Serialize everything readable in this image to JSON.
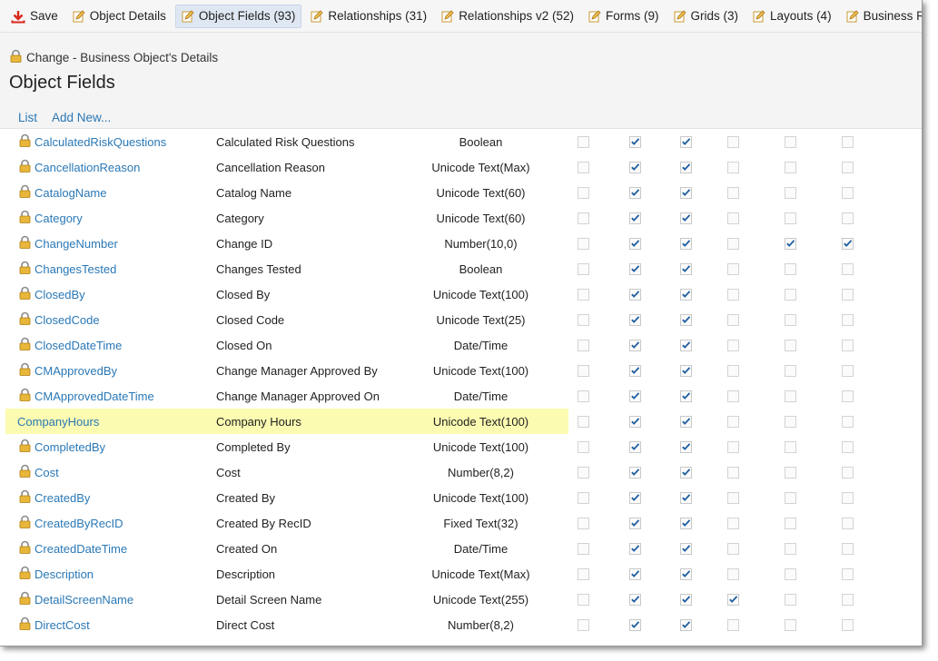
{
  "toolbar": {
    "items": [
      {
        "label": "Save",
        "icon": "save-icon",
        "active": false
      },
      {
        "label": "Object Details",
        "icon": "edit-icon",
        "active": false
      },
      {
        "label": "Object Fields (93)",
        "icon": "edit-icon",
        "active": true
      },
      {
        "label": "Relationships (31)",
        "icon": "edit-icon",
        "active": false
      },
      {
        "label": "Relationships v2 (52)",
        "icon": "edit-icon",
        "active": false
      },
      {
        "label": "Forms (9)",
        "icon": "edit-icon",
        "active": false
      },
      {
        "label": "Grids (3)",
        "icon": "edit-icon",
        "active": false
      },
      {
        "label": "Layouts (4)",
        "icon": "edit-icon",
        "active": false
      },
      {
        "label": "Business Rul",
        "icon": "edit-icon",
        "active": false
      }
    ]
  },
  "header": {
    "business_object": "Change - Business Object's Details",
    "page_title": "Object Fields",
    "links": [
      "List",
      "Add New..."
    ]
  },
  "colors": {
    "link": "#2a78b6",
    "highlight": "#fbfbb1",
    "check": "#1f5fa0"
  },
  "fields": [
    {
      "name": "CalculatedRiskQuestions",
      "display": "Calculated Risk Questions",
      "type": "Boolean",
      "locked": true,
      "checks": [
        false,
        true,
        true,
        false,
        false,
        false
      ]
    },
    {
      "name": "CancellationReason",
      "display": "Cancellation Reason",
      "type": "Unicode Text(Max)",
      "locked": true,
      "checks": [
        false,
        true,
        true,
        false,
        false,
        false
      ]
    },
    {
      "name": "CatalogName",
      "display": "Catalog Name",
      "type": "Unicode Text(60)",
      "locked": true,
      "checks": [
        false,
        true,
        true,
        false,
        false,
        false
      ]
    },
    {
      "name": "Category",
      "display": "Category",
      "type": "Unicode Text(60)",
      "locked": true,
      "checks": [
        false,
        true,
        true,
        false,
        false,
        false
      ]
    },
    {
      "name": "ChangeNumber",
      "display": "Change ID",
      "type": "Number(10,0)",
      "locked": true,
      "checks": [
        false,
        true,
        true,
        false,
        true,
        true
      ]
    },
    {
      "name": "ChangesTested",
      "display": "Changes Tested",
      "type": "Boolean",
      "locked": true,
      "checks": [
        false,
        true,
        true,
        false,
        false,
        false
      ]
    },
    {
      "name": "ClosedBy",
      "display": "Closed By",
      "type": "Unicode Text(100)",
      "locked": true,
      "checks": [
        false,
        true,
        true,
        false,
        false,
        false
      ]
    },
    {
      "name": "ClosedCode",
      "display": "Closed Code",
      "type": "Unicode Text(25)",
      "locked": true,
      "checks": [
        false,
        true,
        true,
        false,
        false,
        false
      ]
    },
    {
      "name": "ClosedDateTime",
      "display": "Closed On",
      "type": "Date/Time",
      "locked": true,
      "checks": [
        false,
        true,
        true,
        false,
        false,
        false
      ]
    },
    {
      "name": "CMApprovedBy",
      "display": "Change Manager Approved By",
      "type": "Unicode Text(100)",
      "locked": true,
      "checks": [
        false,
        true,
        true,
        false,
        false,
        false
      ]
    },
    {
      "name": "CMApprovedDateTime",
      "display": "Change Manager Approved On",
      "type": "Date/Time",
      "locked": true,
      "checks": [
        false,
        true,
        true,
        false,
        false,
        false
      ]
    },
    {
      "name": "CompanyHours",
      "display": "Company Hours",
      "type": "Unicode Text(100)",
      "locked": false,
      "highlight": true,
      "checks": [
        false,
        true,
        true,
        false,
        false,
        false
      ]
    },
    {
      "name": "CompletedBy",
      "display": "Completed By",
      "type": "Unicode Text(100)",
      "locked": true,
      "checks": [
        false,
        true,
        true,
        false,
        false,
        false
      ]
    },
    {
      "name": "Cost",
      "display": "Cost",
      "type": "Number(8,2)",
      "locked": true,
      "checks": [
        false,
        true,
        true,
        false,
        false,
        false
      ]
    },
    {
      "name": "CreatedBy",
      "display": "Created By",
      "type": "Unicode Text(100)",
      "locked": true,
      "checks": [
        false,
        true,
        true,
        false,
        false,
        false
      ]
    },
    {
      "name": "CreatedByRecID",
      "display": "Created By RecID",
      "type": "Fixed Text(32)",
      "locked": true,
      "checks": [
        false,
        true,
        true,
        false,
        false,
        false
      ]
    },
    {
      "name": "CreatedDateTime",
      "display": "Created On",
      "type": "Date/Time",
      "locked": true,
      "checks": [
        false,
        true,
        true,
        false,
        false,
        false
      ]
    },
    {
      "name": "Description",
      "display": "Description",
      "type": "Unicode Text(Max)",
      "locked": true,
      "checks": [
        false,
        true,
        true,
        false,
        false,
        false
      ]
    },
    {
      "name": "DetailScreenName",
      "display": "Detail Screen Name",
      "type": "Unicode Text(255)",
      "locked": true,
      "checks": [
        false,
        true,
        true,
        true,
        false,
        false
      ]
    },
    {
      "name": "DirectCost",
      "display": "Direct Cost",
      "type": "Number(8,2)",
      "locked": true,
      "checks": [
        false,
        true,
        true,
        false,
        false,
        false
      ]
    }
  ]
}
